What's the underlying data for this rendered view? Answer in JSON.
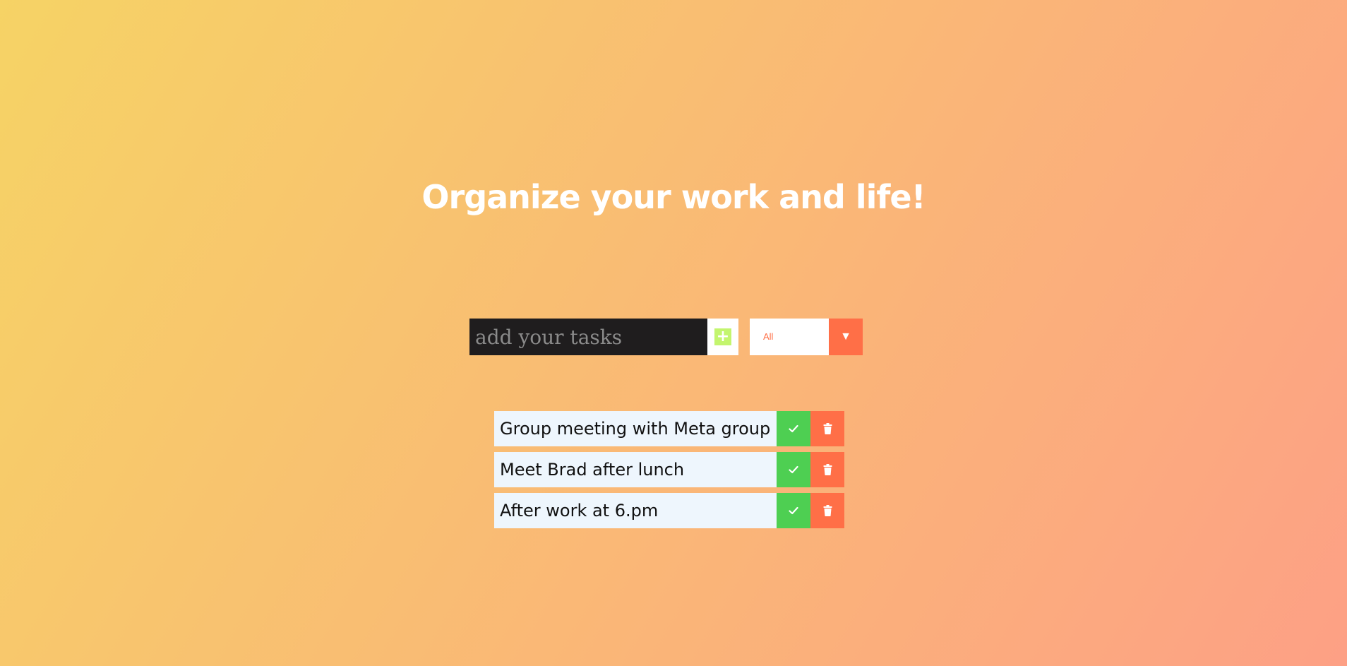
{
  "header": {
    "title": "Organize your work and life!"
  },
  "form": {
    "input_value": "",
    "input_placeholder": "add your tasks",
    "add_icon": "plus-icon"
  },
  "filter": {
    "selected": "All",
    "arrow_icon": "caret-down-icon"
  },
  "todos": [
    {
      "text": "Group meeting with Meta group",
      "complete_icon": "check-icon",
      "delete_icon": "trash-icon"
    },
    {
      "text": "Meet Brad after lunch",
      "complete_icon": "check-icon",
      "delete_icon": "trash-icon"
    },
    {
      "text": "After work at 6.pm",
      "complete_icon": "check-icon",
      "delete_icon": "trash-icon"
    }
  ],
  "colors": {
    "gradient_start": "#f6d365",
    "gradient_end": "#fda085",
    "input_bg": "#1f1d1e",
    "add_icon_bg": "#c3f56e",
    "accent": "#ff6f47",
    "complete": "#4ecf52",
    "todo_bg": "#eef6fd"
  }
}
